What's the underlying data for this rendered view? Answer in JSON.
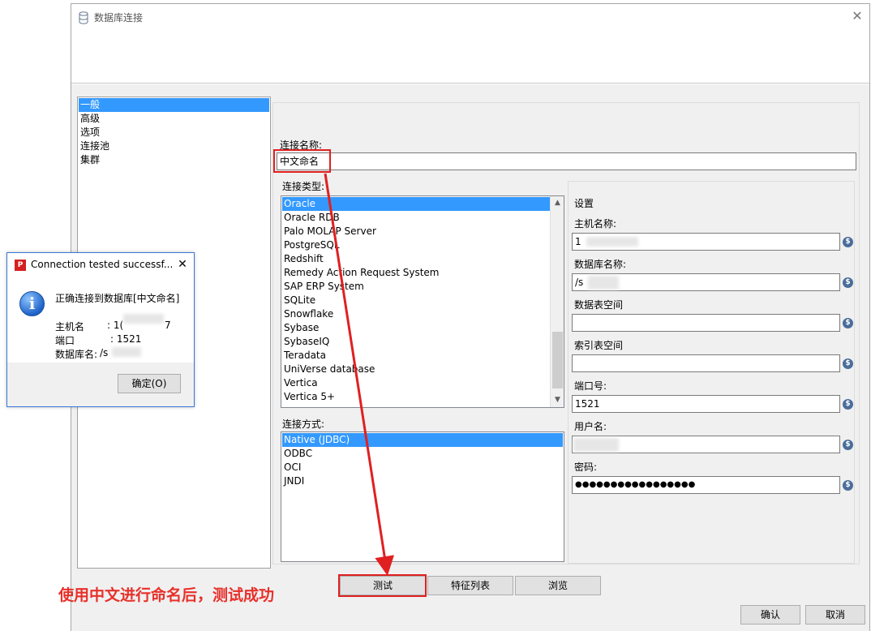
{
  "dialog": {
    "title": "数据库连接",
    "close_glyph": "✕"
  },
  "nav": {
    "items": [
      "一般",
      "高级",
      "选项",
      "连接池",
      "集群"
    ],
    "selected": 0
  },
  "general": {
    "connection_name_label": "连接名称:",
    "connection_name_value": "中文命名",
    "connection_type_label": "连接类型:",
    "connection_types": [
      "Oracle",
      "Oracle RDB",
      "Palo MOLAP Server",
      "PostgreSQL",
      "Redshift",
      "Remedy Action Request System",
      "SAP ERP System",
      "SQLite",
      "Snowflake",
      "Sybase",
      "SybaseIQ",
      "Teradata",
      "UniVerse database",
      "Vertica",
      "Vertica 5+"
    ],
    "selected_type": "Oracle",
    "access_label": "连接方式:",
    "access_methods": [
      "Native (JDBC)",
      "ODBC",
      "OCI",
      "JNDI"
    ],
    "selected_access": "Native (JDBC)"
  },
  "settings": {
    "group_label": "设置",
    "host_label": "主机名称:",
    "host_value": "1",
    "dbname_label": "数据库名称:",
    "dbname_value": "/s",
    "tablespace_label": "数据表空间",
    "tablespace_value": "",
    "indexspace_label": "索引表空间",
    "indexspace_value": "",
    "port_label": "端口号:",
    "port_value": "1521",
    "username_label": "用户名:",
    "username_value": "",
    "password_label": "密码:",
    "password_value": "●●●●●●●●●●●●●●●●●",
    "var_glyph": "$"
  },
  "buttons": {
    "test": "测试",
    "feature_list": "特征列表",
    "browse": "浏览",
    "ok": "确认",
    "cancel": "取消"
  },
  "popup": {
    "title": "Connection tested successf...",
    "close_glyph": "✕",
    "app_icon_glyph": "P",
    "info_glyph": "i",
    "message": "正确连接到数据库[中文命名]",
    "host_label": "主机名",
    "host_value": ": 1(",
    "host_suffix": "7",
    "port_label": "端口",
    "port_value": ": 1521",
    "db_label": "数据库名:",
    "db_value": "/s",
    "ok_button": "确定(O)"
  },
  "annotation": {
    "text": "使用中文进行命名后，测试成功",
    "color": "#e8302a"
  },
  "icons": {
    "title_icon": "database-icon",
    "popup_app_icon": "pentaho-app-icon",
    "popup_info_icon": "info-icon",
    "variable_icon": "variable-dollar-icon"
  }
}
